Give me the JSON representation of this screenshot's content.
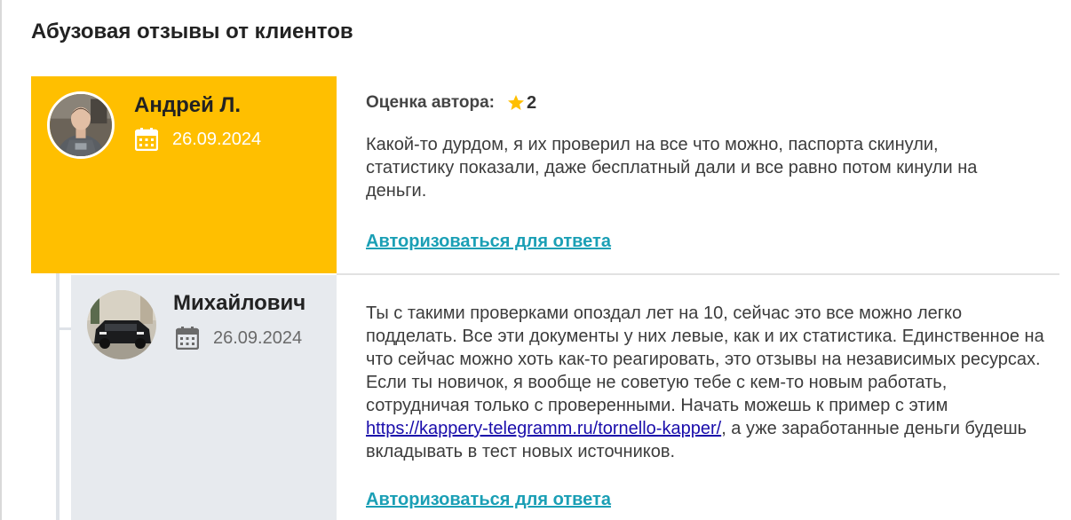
{
  "section": {
    "title": "Абузовая отзывы от клиентов"
  },
  "colors": {
    "accent_yellow": "#ffbf00",
    "reply_panel": "#e7eaee",
    "link_teal": "#1a9fb5",
    "url_blue": "#1a0dab"
  },
  "reviews": [
    {
      "author": "Андрей Л.",
      "date": "26.09.2024",
      "rating_label": "Оценка автора:",
      "rating_value": "2",
      "rating_icon": "star-icon",
      "date_icon": "calendar-icon",
      "text": "Какой-то дурдом, я их проверил на все что можно, паспорта скинули, статистику показали, даже бесплатный дали и все равно потом кинули на деньги.",
      "reply_link": "Авторизоваться для ответа"
    },
    {
      "author": "Михайлович",
      "date": "26.09.2024",
      "date_icon": "calendar-icon",
      "text_before_link": "Ты с такими проверками опоздал лет на 10, сейчас это все можно легко подделать. Все эти документы у них левые, как и их статистика. Единственное на что сейчас можно хоть как-то реагировать, это отзывы на независимых ресурсах. Если ты новичок, я вообще не советую тебе с кем-то новым работать, сотрудничая только с проверенными. Начать можешь к пример с этим ",
      "link_text": "https://kappery-telegramm.ru/tornello-kapper/",
      "text_after_link": ", а уже заработанные деньги будешь вкладывать в тест новых источников.",
      "reply_link": "Авторизоваться для ответа"
    }
  ]
}
